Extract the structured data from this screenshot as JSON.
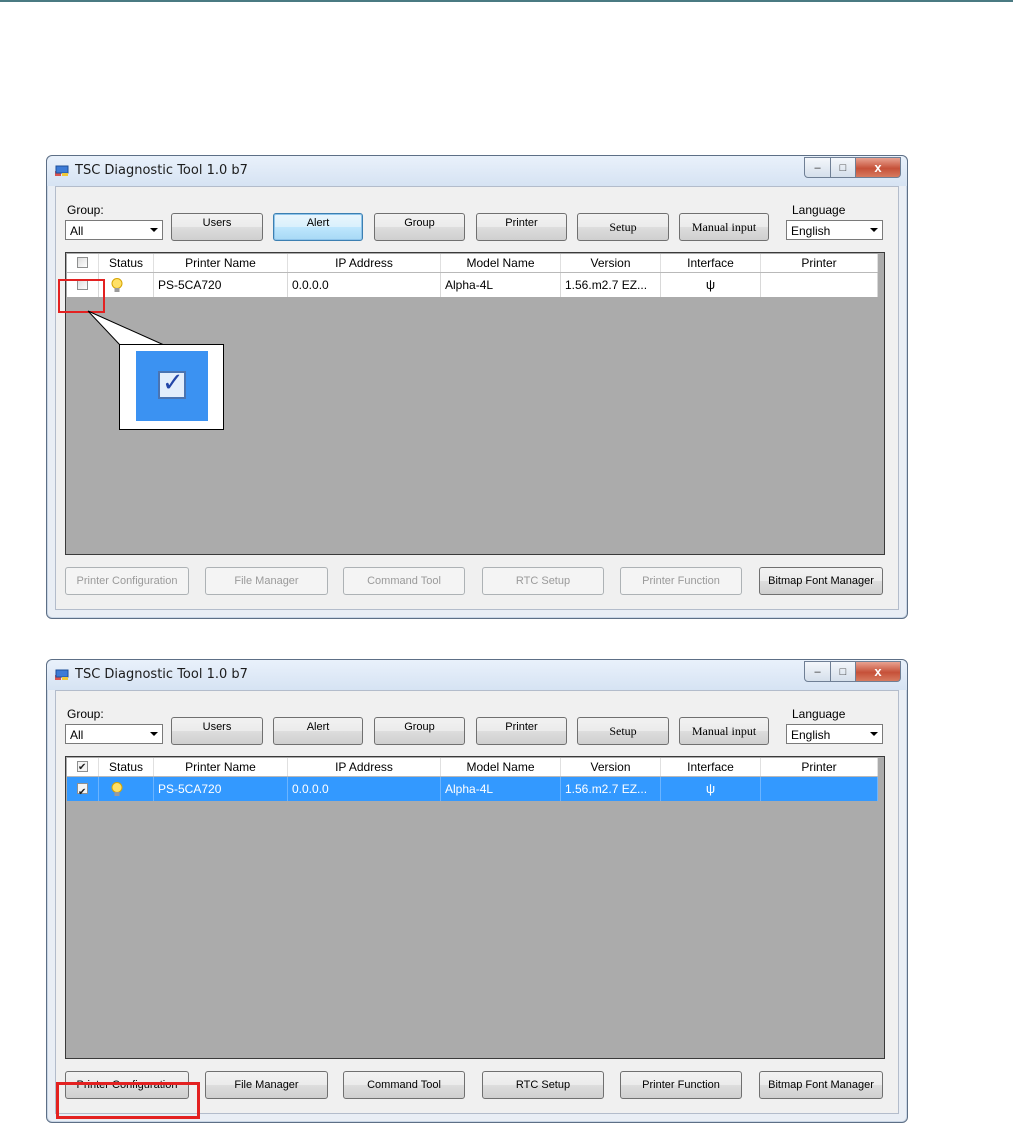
{
  "window_title": "TSC Diagnostic Tool 1.0 b7",
  "window_controls": {
    "minimize": "–",
    "maximize": "□",
    "close": "x"
  },
  "group_label": "Group:",
  "group_value": "All",
  "language_label": "Language",
  "language_value": "English",
  "toolbar": {
    "users": "Users",
    "alert": "Alert",
    "group": "Group",
    "printer": "Printer",
    "setup": "Setup",
    "manual_input": "Manual input"
  },
  "columns": [
    "Status",
    "Printer Name",
    "IP Address",
    "Model Name",
    "Version",
    "Interface",
    "Printer"
  ],
  "row": {
    "printer_name": "PS-5CA720",
    "ip_address": "0.0.0.0",
    "model_name": "Alpha-4L",
    "version": "1.56.m2.7 EZ..."
  },
  "bottom_buttons": {
    "printer_configuration": "Printer Configuration",
    "file_manager": "File Manager",
    "command_tool": "Command Tool",
    "rtc_setup": "RTC Setup",
    "printer_function": "Printer Function",
    "bitmap_font_manager": "Bitmap Font Manager"
  },
  "icons": {
    "status": "lightbulb-icon",
    "interface": "usb-icon"
  },
  "colors": {
    "selection": "#3399ff",
    "highlight_box": "#e32121",
    "grid_background": "#ababab"
  }
}
